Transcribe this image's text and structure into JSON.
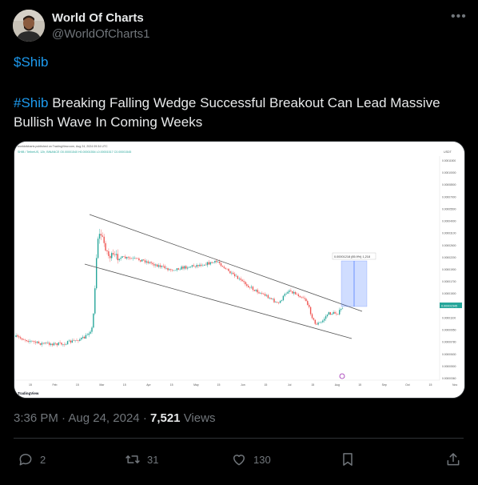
{
  "author": {
    "name": "World Of Charts",
    "handle": "@WorldOfCharts1"
  },
  "post": {
    "cashtag": "$Shib",
    "hashtag": "#Shib",
    "text": " Breaking Falling Wedge Successful Breakout Can Lead Massive Bullish Wave In Coming Weeks",
    "time": "3:36 PM",
    "separator": "·",
    "date": "Aug 24, 2024",
    "views_count": "7,521",
    "views_label": " Views"
  },
  "actions": {
    "replies": "2",
    "reposts": "31",
    "likes": "130"
  },
  "chart_image": {
    "header_line1": "worldofcharts published on TradingView.com, Aug 24, 2024 09:34 UTC",
    "header_line2": "SHIB / TetherUS, 12h, BINANCE  O0.00001540  H0.00001554  L0.00001517  C0.00001545",
    "measure_label": "0.00001218 (85.9%) 1,218",
    "current_price": "0.00001545",
    "currency": "USDT",
    "x_ticks": [
      "15",
      "Feb",
      "15",
      "Mar",
      "15",
      "Apr",
      "15",
      "May",
      "15",
      "Jun",
      "15",
      "Jul",
      "15",
      "Aug",
      "15",
      "Sep",
      "Oct",
      "15",
      "Nov"
    ],
    "y_ticks": [
      "0.00011500",
      "0.00010000",
      "0.00008500",
      "0.00007000",
      "0.00005500",
      "0.00004000",
      "0.00003100",
      "0.00002600",
      "0.00002200",
      "0.00001900",
      "0.00001700",
      "0.00001500",
      "0.00001300",
      "0.00001100",
      "0.00000950",
      "0.00000780",
      "0.00000630",
      "0.00000500",
      "0.00000360"
    ],
    "brand": "TradingView",
    "colors": {
      "up": "#26a69a",
      "down": "#ef5350",
      "wedge": "#555555",
      "measure": "#2962ff"
    }
  },
  "icons": {
    "more": "more-icon",
    "reply": "reply-icon",
    "repost": "repost-icon",
    "like": "like-icon",
    "bookmark": "bookmark-icon",
    "share": "share-icon"
  }
}
